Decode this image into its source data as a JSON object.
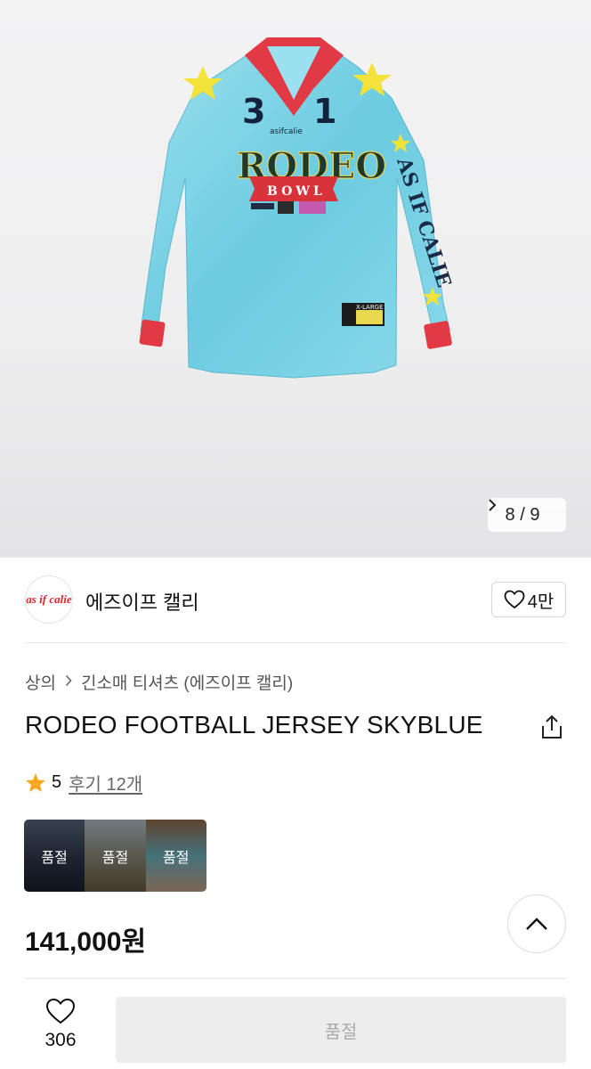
{
  "gallery": {
    "pager": "8 / 9"
  },
  "brand": {
    "logo_text": "as if calie",
    "name": "에즈이프 캘리",
    "likes": "4만"
  },
  "breadcrumb": {
    "category": "상의",
    "subcategory": "긴소매 티셔츠 (에즈이프 캘리)"
  },
  "product": {
    "title": "RODEO FOOTBALL JERSEY SKYBLUE",
    "rating": "5",
    "reviews": "후기 12개",
    "price": "141,000원"
  },
  "thumbnails": [
    {
      "label": "품절"
    },
    {
      "label": "품절"
    },
    {
      "label": "품절"
    }
  ],
  "jersey": {
    "number_left": "3",
    "number_right": "1",
    "brand_small": "asifcalie",
    "main_text": "RODEO",
    "ribbon_text": "BOWL",
    "sleeve_text": "AS IF CALIE",
    "size_tag": "X-LARGE"
  },
  "footer": {
    "wish_count": "306",
    "buy_label": "품절"
  },
  "colors": {
    "accent_star": "#f5a623",
    "jersey": "#7fd3e6",
    "trim": "#e23a44"
  }
}
